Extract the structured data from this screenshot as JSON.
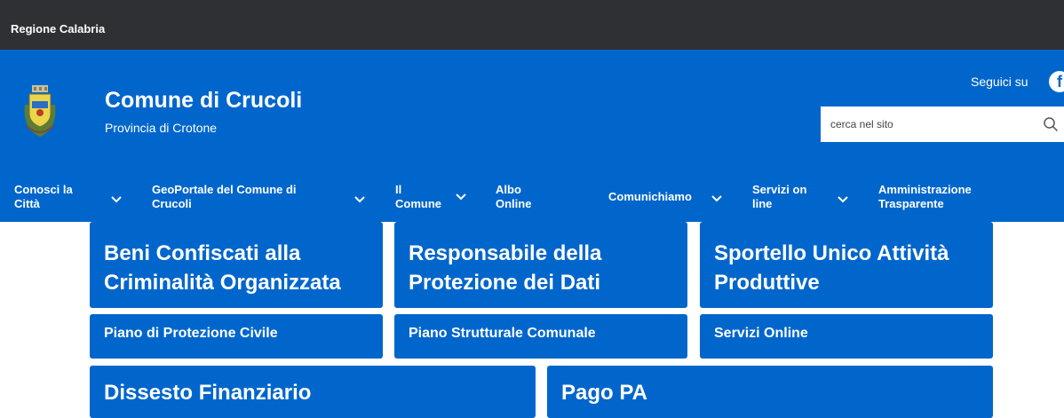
{
  "topbar": {
    "region": "Regione Calabria"
  },
  "header": {
    "title": "Comune di Crucoli",
    "subtitle": "Provincia di Crotone",
    "follow_label": "Seguici su",
    "search": {
      "placeholder": "cerca nel sito"
    }
  },
  "nav": {
    "items": [
      {
        "line1": "Conosci la",
        "line2": "Città"
      },
      {
        "line1": "GeoPortale del Comune di",
        "line2": "Crucoli"
      },
      {
        "line1": "Il",
        "line2": "Comune"
      },
      {
        "line1": "Albo",
        "line2": "Online"
      },
      {
        "line1": "Comunichiamo",
        "line2": ""
      },
      {
        "line1": "Servizi on",
        "line2": "line"
      },
      {
        "line1": "Amministrazione",
        "line2": "Trasparente"
      }
    ]
  },
  "tiles": {
    "row1": [
      {
        "line1": "Beni Confiscati alla",
        "line2": "Criminalità Organizzata"
      },
      {
        "line1": "Responsabile della",
        "line2": "Protezione dei Dati"
      },
      {
        "line1": "Sportello Unico Attività",
        "line2": "Produttive"
      }
    ],
    "row2": [
      {
        "label": "Piano di Protezione Civile"
      },
      {
        "label": "Piano Strutturale Comunale"
      },
      {
        "label": "Servizi Online"
      }
    ],
    "row3": [
      {
        "label": "Dissesto Finanziario"
      },
      {
        "label": "Pago PA"
      }
    ]
  },
  "colors": {
    "topbar": "#2f3033",
    "brand": "#0066cc",
    "text": "#ffffff"
  },
  "icons": [
    "coat-of-arms-icon",
    "facebook-icon",
    "search-icon",
    "chevron-down-icon"
  ]
}
